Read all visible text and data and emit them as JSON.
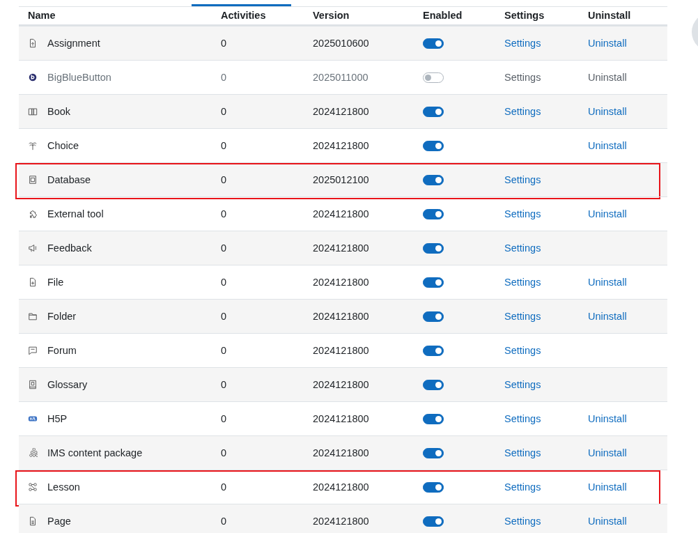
{
  "columns": [
    "Name",
    "Activities",
    "Version",
    "Enabled",
    "Settings",
    "Uninstall"
  ],
  "rows": [
    {
      "name": "Assignment",
      "activities": "0",
      "version": "2025010600",
      "enabled": true,
      "settings": "Settings",
      "uninstall": "Uninstall",
      "highlighted": false
    },
    {
      "name": "BigBlueButton",
      "activities": "0",
      "version": "2025011000",
      "enabled": false,
      "settings": "Settings",
      "uninstall": "Uninstall",
      "highlighted": false
    },
    {
      "name": "Book",
      "activities": "0",
      "version": "2024121800",
      "enabled": true,
      "settings": "Settings",
      "uninstall": "Uninstall",
      "highlighted": false
    },
    {
      "name": "Choice",
      "activities": "0",
      "version": "2024121800",
      "enabled": true,
      "uninstall": "Uninstall",
      "highlighted": false
    },
    {
      "name": "Database",
      "activities": "0",
      "version": "2025012100",
      "enabled": true,
      "settings": "Settings",
      "highlighted": true
    },
    {
      "name": "External tool",
      "activities": "0",
      "version": "2024121800",
      "enabled": true,
      "settings": "Settings",
      "uninstall": "Uninstall",
      "highlighted": false
    },
    {
      "name": "Feedback",
      "activities": "0",
      "version": "2024121800",
      "enabled": true,
      "settings": "Settings",
      "highlighted": false
    },
    {
      "name": "File",
      "activities": "0",
      "version": "2024121800",
      "enabled": true,
      "settings": "Settings",
      "uninstall": "Uninstall",
      "highlighted": false
    },
    {
      "name": "Folder",
      "activities": "0",
      "version": "2024121800",
      "enabled": true,
      "settings": "Settings",
      "uninstall": "Uninstall",
      "highlighted": false
    },
    {
      "name": "Forum",
      "activities": "0",
      "version": "2024121800",
      "enabled": true,
      "settings": "Settings",
      "highlighted": false
    },
    {
      "name": "Glossary",
      "activities": "0",
      "version": "2024121800",
      "enabled": true,
      "settings": "Settings",
      "highlighted": false
    },
    {
      "name": "H5P",
      "activities": "0",
      "version": "2024121800",
      "enabled": true,
      "settings": "Settings",
      "uninstall": "Uninstall",
      "highlighted": false
    },
    {
      "name": "IMS content package",
      "activities": "0",
      "version": "2024121800",
      "enabled": true,
      "settings": "Settings",
      "uninstall": "Uninstall",
      "highlighted": false
    },
    {
      "name": "Lesson",
      "activities": "0",
      "version": "2024121800",
      "enabled": true,
      "settings": "Settings",
      "uninstall": "Uninstall",
      "highlighted": true
    },
    {
      "name": "Page",
      "activities": "0",
      "version": "2024121800",
      "enabled": true,
      "settings": "Settings",
      "uninstall": "Uninstall",
      "highlighted": false
    }
  ]
}
